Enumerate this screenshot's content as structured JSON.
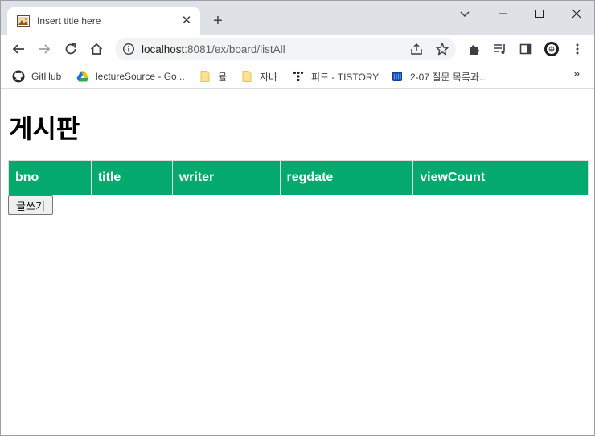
{
  "tab": {
    "title": "Insert title here",
    "close_glyph": "✕",
    "new_tab_glyph": "+"
  },
  "address_bar": {
    "url_host": "localhost",
    "url_rest": ":8081/ex/board/listAll"
  },
  "bookmarks": [
    {
      "label": "GitHub",
      "icon": "github-icon"
    },
    {
      "label": "lectureSource - Go...",
      "icon": "google-drive-icon"
    },
    {
      "label": "뮬",
      "icon": "folder-icon"
    },
    {
      "label": "자바",
      "icon": "folder-icon"
    },
    {
      "label": "피드 - TISTORY",
      "icon": "tistory-icon"
    },
    {
      "label": "2-07 질문 목록과...",
      "icon": "bookmark-book-icon"
    }
  ],
  "bookmarks_more_glyph": "»",
  "page": {
    "heading": "게시판",
    "table_headers": [
      "bno",
      "title",
      "writer",
      "regdate",
      "viewCount"
    ],
    "write_button_label": "글쓰기"
  },
  "colors": {
    "table_header_bg": "#04aa6d",
    "tabstrip_bg": "#dee1e6",
    "omnibox_bg": "#f1f3f4"
  }
}
